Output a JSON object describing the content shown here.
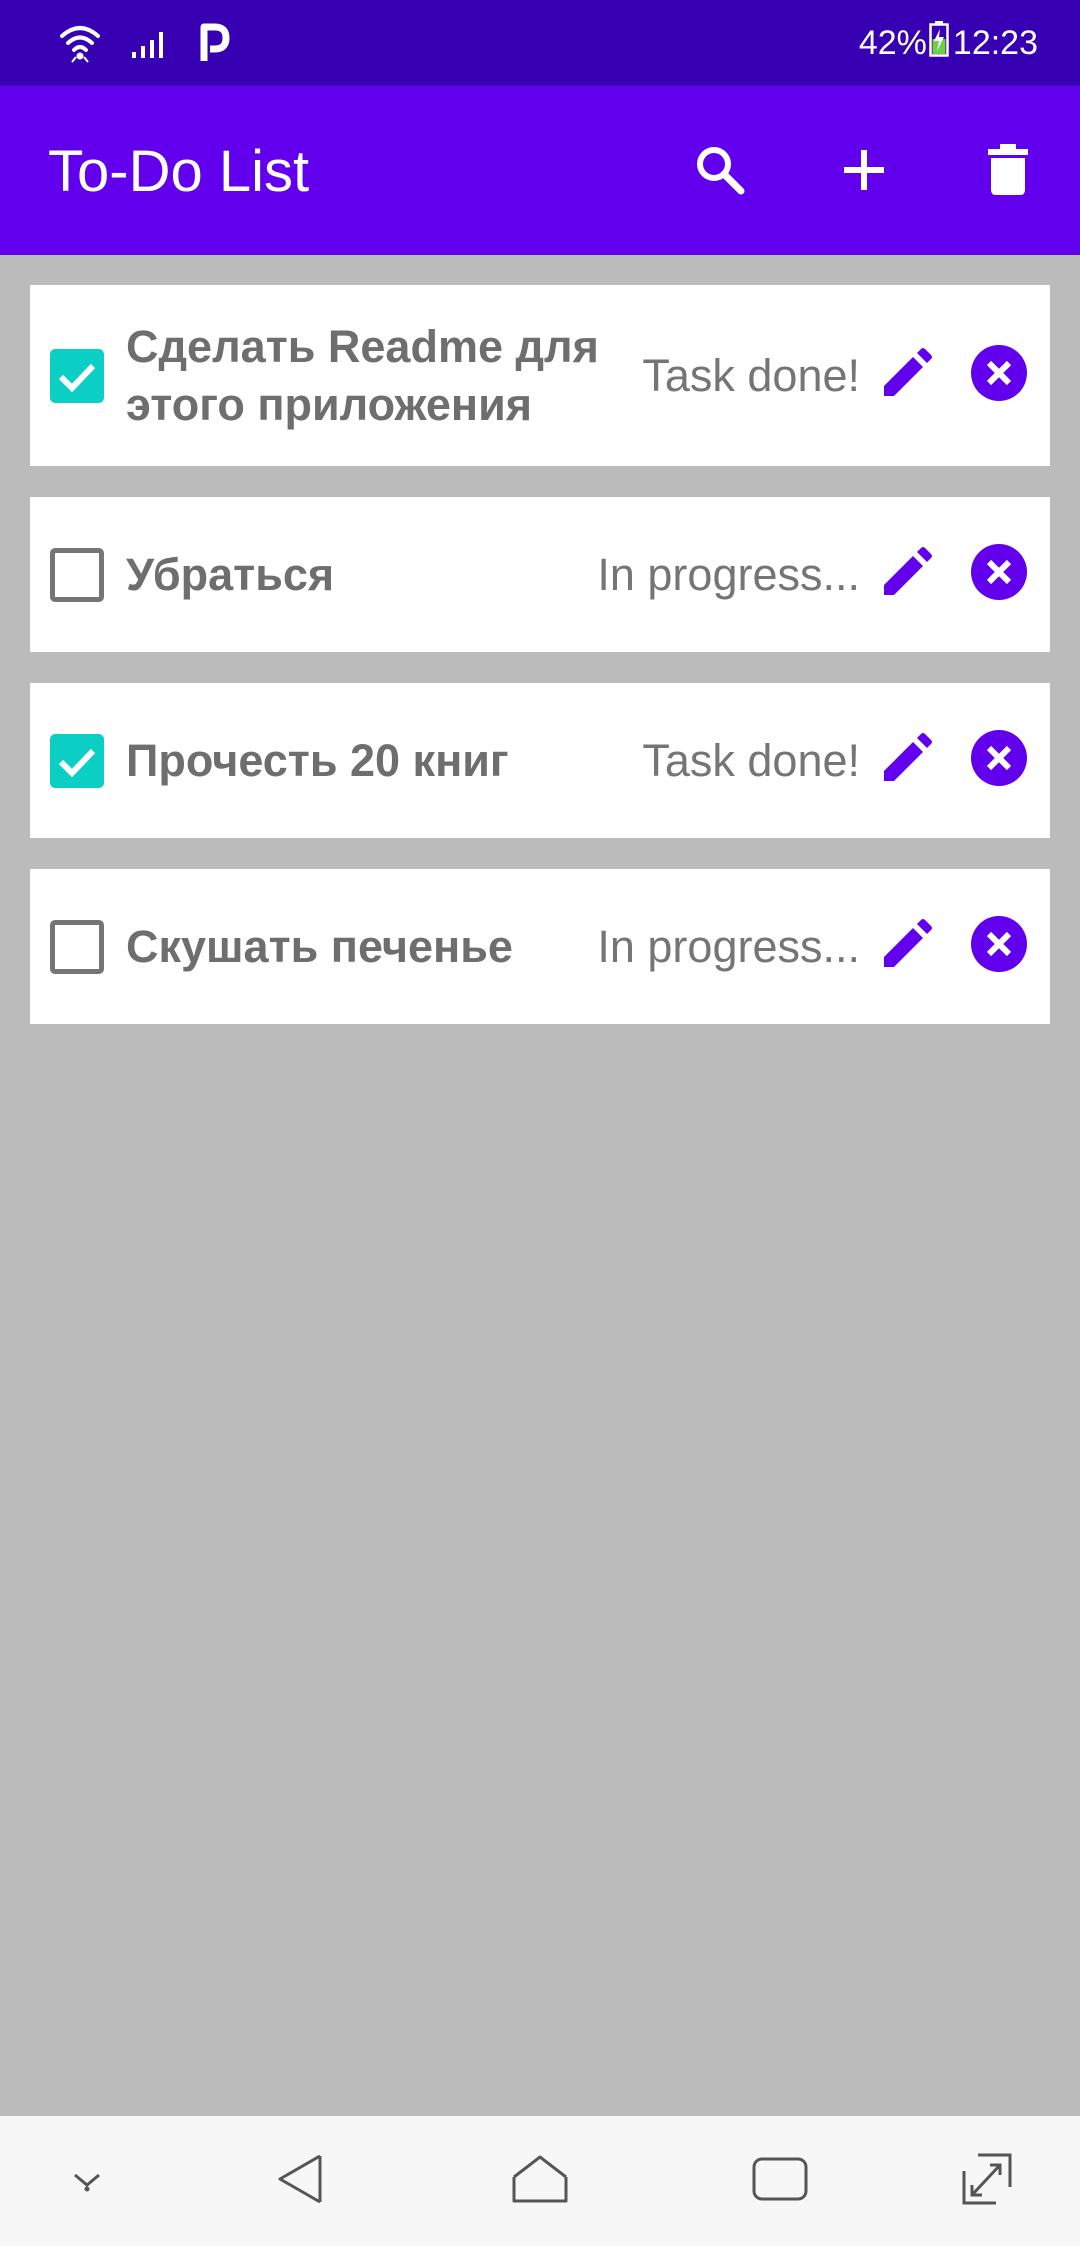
{
  "status_bar": {
    "battery_percent": "42%",
    "time": "12:23",
    "icons": [
      "wifi-icon",
      "signal-icon",
      "parking-app-icon",
      "battery-charging-icon"
    ]
  },
  "app_bar": {
    "title": "To-Do List",
    "actions": [
      {
        "name": "search",
        "icon": "search-icon"
      },
      {
        "name": "add",
        "icon": "add-icon"
      },
      {
        "name": "delete-all",
        "icon": "trash-icon"
      }
    ]
  },
  "tasks": [
    {
      "title": "Сделать Readme для этого приложения",
      "status": "Task done!",
      "done": true
    },
    {
      "title": "Убраться",
      "status": "In progress...",
      "done": false
    },
    {
      "title": "Прочесть 20 книг",
      "status": "Task done!",
      "done": true
    },
    {
      "title": "Скушать печенье",
      "status": "In progress...",
      "done": false
    }
  ],
  "nav_bar": {
    "buttons": [
      "hide-keyboard-icon",
      "back-icon",
      "home-icon",
      "recent-apps-icon",
      "expand-icon"
    ]
  },
  "colors": {
    "status_bar": "#3700B3",
    "app_bar": "#6200EE",
    "accent": "#6200EE",
    "checkbox_checked": "#0BCFC5",
    "background": "#BBBBBB",
    "card": "#FFFFFF",
    "text": "#6E6E6E"
  }
}
